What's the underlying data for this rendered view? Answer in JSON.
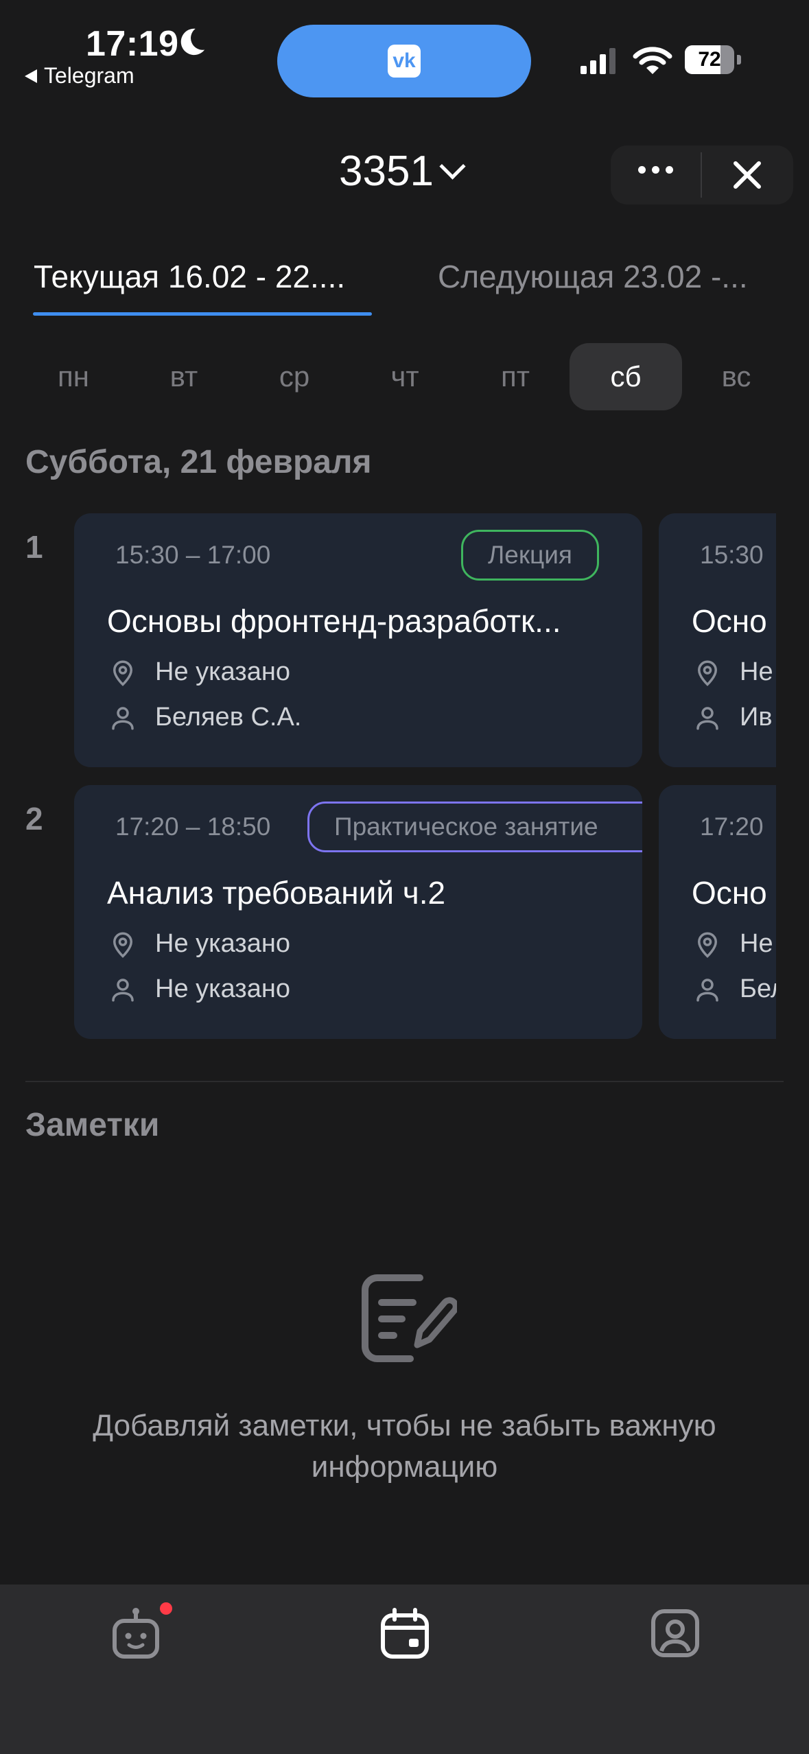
{
  "status_bar": {
    "time": "17:19",
    "back_label": "Telegram",
    "battery": "72",
    "battery_level": 0.72
  },
  "header": {
    "group": "3351"
  },
  "week_tabs": [
    {
      "label": "Текущая 16.02 - 22...."
    },
    {
      "label": "Следующая 23.02 -..."
    }
  ],
  "days": [
    "пн",
    "вт",
    "ср",
    "чт",
    "пт",
    "сб",
    "вс"
  ],
  "selected_day": "сб",
  "date_title": "Суббота, 21 февраля",
  "lessons": [
    {
      "number": "1",
      "cards": [
        {
          "time": "15:30 – 17:00",
          "type": "Лекция",
          "title": "Основы фронтенд-разработк...",
          "location": "Не указано",
          "teacher": "Беляев С.А."
        },
        {
          "time": "15:30",
          "title": "Осно",
          "location": "Не",
          "teacher": "Ив"
        }
      ]
    },
    {
      "number": "2",
      "cards": [
        {
          "time": "17:20 – 18:50",
          "type": "Практическое занятие",
          "title": "Анализ требований ч.2",
          "location": "Не указано",
          "teacher": "Не указано"
        },
        {
          "time": "17:20",
          "title": "Осно",
          "location": "Не",
          "teacher": "Бел"
        }
      ]
    }
  ],
  "notes": {
    "title": "Заметки",
    "empty_text": "Добавляй заметки, чтобы не забыть важную информацию"
  },
  "nav": {
    "items": [
      {
        "icon": "bot-icon",
        "has_badge": true
      },
      {
        "icon": "calendar-icon",
        "active": true
      },
      {
        "icon": "profile-icon"
      }
    ]
  },
  "colors": {
    "accent": "#3f8ef0",
    "lecture": "#3fb55e",
    "practice": "#7d74f0",
    "badge_dot": "#ff3b47"
  }
}
